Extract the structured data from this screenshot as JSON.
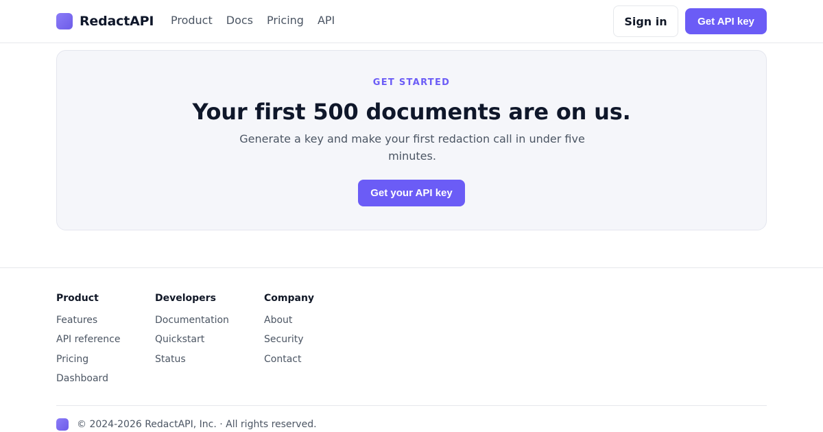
{
  "header": {
    "brand_name": "RedactAPI",
    "nav": [
      "Product",
      "Docs",
      "Pricing",
      "API"
    ],
    "sign_in_label": "Sign in",
    "cta_label": "Get API key"
  },
  "cta": {
    "eyebrow": "GET STARTED",
    "title": "Your first 500 documents are on us.",
    "subtitle": "Generate a key and make your first redaction call in under five minutes.",
    "button_label": "Get your API key"
  },
  "footer": {
    "columns": [
      {
        "heading": "Product",
        "links": [
          "Features",
          "API reference",
          "Pricing",
          "Dashboard"
        ]
      },
      {
        "heading": "Developers",
        "links": [
          "Documentation",
          "Quickstart",
          "Status"
        ]
      },
      {
        "heading": "Company",
        "links": [
          "About",
          "Security",
          "Contact"
        ]
      }
    ],
    "copyright": "© 2024-2026 RedactAPI, Inc. · All rights reserved."
  },
  "colors": {
    "accent": "#6b5cf6",
    "card_background": "#f5f6fa",
    "heading": "#0f172a",
    "muted_text": "#4b5563"
  }
}
